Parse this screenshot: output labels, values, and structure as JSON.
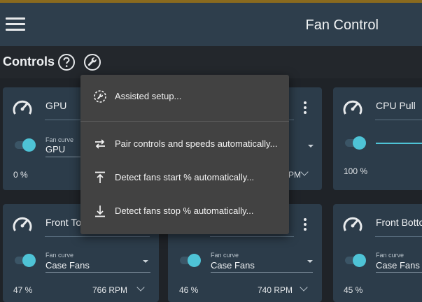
{
  "app": {
    "title": "Fan Control"
  },
  "subbar": {
    "title": "Controls"
  },
  "colors": {
    "accent": "#4ec3d6",
    "appbar": "#2e3e4c",
    "card": "#2c3c4a",
    "menu": "#424242"
  },
  "cards": {
    "gpu": {
      "name": "GPU",
      "fan_curve_label": "Fan curve",
      "fan_curve_value": "GPU",
      "percent": "0 %"
    },
    "middle_top": {
      "rpm_suffix": "PM"
    },
    "cpu_pull": {
      "name": "CPU Pull",
      "percent": "100 %"
    },
    "front_top": {
      "name": "Front To",
      "fan_curve_label": "Fan curve",
      "fan_curve_value": "Case Fans",
      "percent": "47 %",
      "rpm": "766 RPM"
    },
    "middle_bottom": {
      "fan_curve_label": "Fan curve",
      "fan_curve_value": "Case Fans",
      "percent": "46 %",
      "rpm": "740 RPM"
    },
    "front_bottom": {
      "name": "Front Botto",
      "fan_curve_label": "Fan curve",
      "fan_curve_value": "Case Fans",
      "percent": "45 %"
    }
  },
  "menu": {
    "items": [
      {
        "label": "Assisted setup...",
        "icon": "assisted-setup-icon"
      },
      {
        "label": "Pair controls and speeds automatically...",
        "icon": "swap-arrows-icon"
      },
      {
        "label": "Detect fans start % automatically...",
        "icon": "detect-start-icon"
      },
      {
        "label": "Detect fans stop % automatically...",
        "icon": "detect-stop-icon"
      }
    ]
  }
}
